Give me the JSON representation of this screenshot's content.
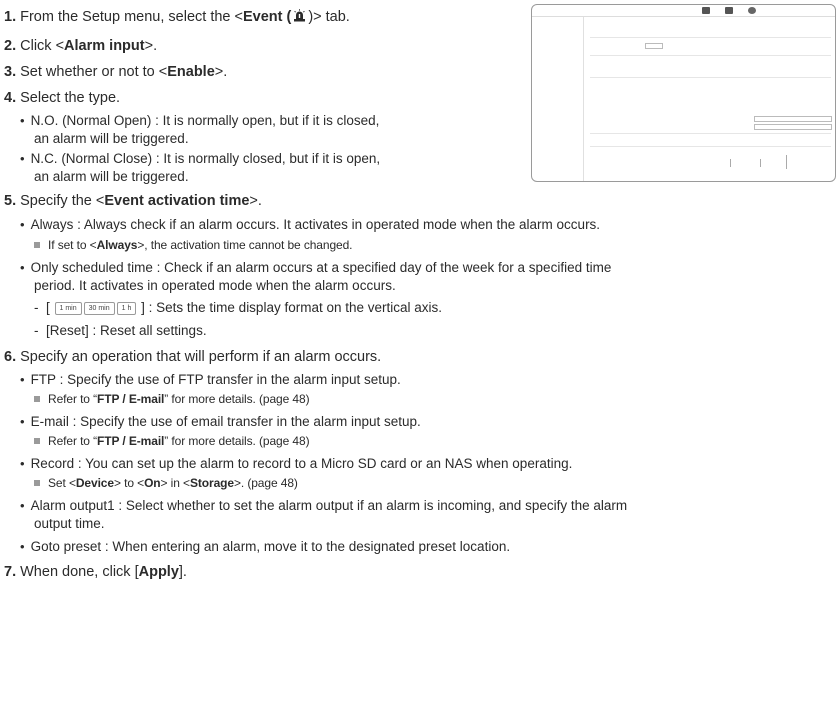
{
  "steps": {
    "s1": {
      "num": "1.",
      "pre": "From the Setup menu, select the <",
      "bold": "Event (",
      "post": ")> tab."
    },
    "s2": {
      "num": "2.",
      "pre": "Click <",
      "bold": "Alarm input",
      "post": ">."
    },
    "s3": {
      "num": "3.",
      "pre": "Set whether or not to <",
      "bold": "Enable",
      "post": ">."
    },
    "s4": {
      "num": "4.",
      "text": "Select the type."
    },
    "s4_no": [
      "N.O. (Normal Open) : It is normally open, but if it is closed,",
      "an alarm will be triggered."
    ],
    "s4_nc": [
      "N.C. (Normal Close) : It is normally closed, but if it is open,",
      "an alarm will be triggered."
    ],
    "s5": {
      "num": "5.",
      "pre": "Specify the <",
      "bold": "Event activation time",
      "post": ">."
    },
    "s5_always": "Always : Always check if an alarm occurs. It activates in operated mode when the alarm occurs.",
    "s5_always_note": {
      "pre": "If set to <",
      "bold": "Always",
      "post": ">, the activation time cannot be changed."
    },
    "s5_sched": [
      "Only scheduled time : Check if an alarm occurs at a specified day of the week for a specified time",
      "period. It activates in operated mode when the alarm occurs."
    ],
    "s5_btns": [
      "1 min",
      "30 min",
      "1 h"
    ],
    "s5_btn_text": "] : Sets the time display format on the vertical axis.",
    "s5_reset": "[Reset] : Reset all settings.",
    "s6": {
      "num": "6.",
      "text": "Specify an operation that will perform if an alarm occurs."
    },
    "s6_ftp": "FTP : Specify the use of FTP transfer in the alarm input setup.",
    "s6_ftp_note": {
      "pre": "Refer to “",
      "bold": "FTP / E-mail",
      "post": "” for more details. (page 48)"
    },
    "s6_email": "E-mail : Specify the use of email transfer in the alarm input setup.",
    "s6_email_note": {
      "pre": "Refer to “",
      "bold": "FTP / E-mail",
      "post": "” for more details. (page 48)"
    },
    "s6_record": "Record : You can set up the alarm to record to a Micro SD card or an NAS when operating.",
    "s6_record_note": {
      "p1": "Set <",
      "b1": "Device",
      "p2": "> to <",
      "b2": "On",
      "p3": "> in <",
      "b3": "Storage",
      "p4": ">. (page 48)"
    },
    "s6_alarm": [
      "Alarm output1 : Select whether to set the alarm output if an alarm is incoming, and specify the alarm",
      "output time."
    ],
    "s6_goto": "Goto preset : When entering an alarm, move it to the designated preset location.",
    "s7": {
      "num": "7.",
      "pre": "When done, click [",
      "bold": "Apply",
      "post": "]."
    }
  },
  "icons": {
    "event": "event-siren-icon",
    "bullet": "bullet",
    "note": "note-square-icon"
  },
  "colors": {
    "text": "#2b2b2b",
    "note_square": "#9a9a9a"
  }
}
